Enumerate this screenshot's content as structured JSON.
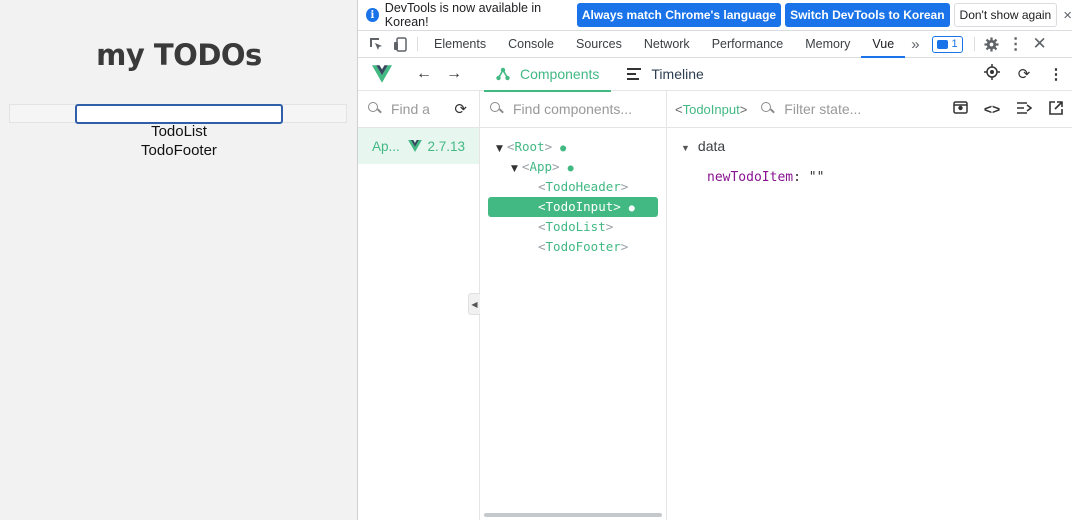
{
  "page": {
    "title": "my TODOs",
    "list_label": "TodoList",
    "footer_label": "TodoFooter"
  },
  "infobar": {
    "message": "DevTools is now available in Korean!",
    "btn_match": "Always match Chrome's language",
    "btn_switch": "Switch DevTools to Korean",
    "btn_dont_show": "Don't show again",
    "close": "×"
  },
  "tabs": {
    "items": [
      "Elements",
      "Console",
      "Sources",
      "Network",
      "Performance",
      "Memory",
      "Vue"
    ],
    "active": "Vue",
    "overflow": "»",
    "badge_count": "1"
  },
  "vue": {
    "tab_components": "Components",
    "tab_timeline": "Timeline"
  },
  "apps_panel": {
    "search_placeholder": "Find a",
    "app_name": "Ap...",
    "version": "2.7.13"
  },
  "tree_panel": {
    "search_placeholder": "Find components...",
    "nodes": [
      {
        "name": "Root",
        "indent": 0,
        "expanded": true,
        "dot": true
      },
      {
        "name": "App",
        "indent": 1,
        "expanded": true,
        "dot": true
      },
      {
        "name": "TodoHeader",
        "indent": 2
      },
      {
        "name": "TodoInput",
        "indent": 2,
        "selected": true,
        "dot": true
      },
      {
        "name": "TodoList",
        "indent": 2
      },
      {
        "name": "TodoFooter",
        "indent": 2
      }
    ]
  },
  "inspector": {
    "selected": "TodoInput",
    "filter_placeholder": "Filter state...",
    "section": "data",
    "key": "newTodoItem",
    "value": "\"\""
  },
  "colors": {
    "vue_green": "#42b883",
    "chrome_blue": "#1a73e8",
    "key_purple": "#881391"
  }
}
